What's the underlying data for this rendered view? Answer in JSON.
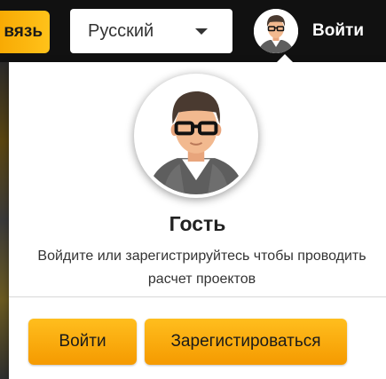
{
  "header": {
    "feedback_label": "вязь",
    "language": {
      "selected": "Русский"
    },
    "login_label": "Войти"
  },
  "profile_panel": {
    "name": "Гость",
    "description": "Войдите или зарегистрируйтесь чтобы проводить расчет проектов",
    "login_button": "Войти",
    "register_button": "Зарегистироваться"
  },
  "icons": {
    "avatar": "guest-avatar-icon",
    "dropdown": "chevron-down-icon"
  },
  "colors": {
    "accent_start": "#ffbe1e",
    "accent_end": "#f59a00",
    "topbar": "#111111",
    "panel": "#ffffff"
  }
}
